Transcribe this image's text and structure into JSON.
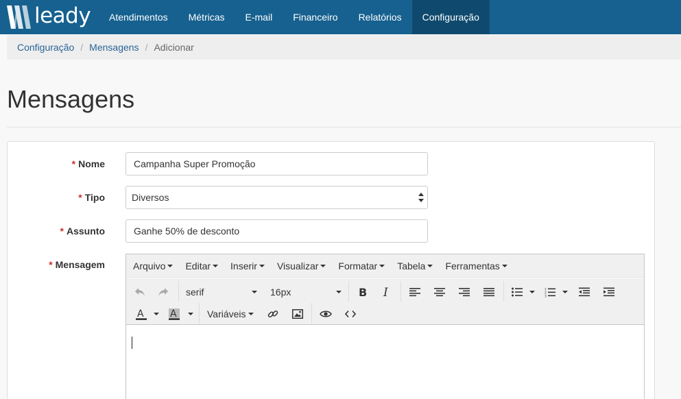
{
  "app": {
    "logo_text": "leady"
  },
  "nav": {
    "items": [
      {
        "label": "Atendimentos"
      },
      {
        "label": "Métricas"
      },
      {
        "label": "E-mail"
      },
      {
        "label": "Financeiro"
      },
      {
        "label": "Relatórios"
      },
      {
        "label": "Configuração",
        "active": true
      }
    ]
  },
  "breadcrumb": {
    "items": [
      "Configuração",
      "Mensagens",
      "Adicionar"
    ],
    "separator": "/"
  },
  "page": {
    "title": "Mensagens"
  },
  "form": {
    "required_marker": "*",
    "nome": {
      "label": "Nome",
      "value": "Campanha Super Promoção"
    },
    "tipo": {
      "label": "Tipo",
      "value": "Diversos"
    },
    "assunto": {
      "label": "Assunto",
      "value": "Ganhe 50% de desconto"
    },
    "mensagem": {
      "label": "Mensagem"
    }
  },
  "editor": {
    "menus": [
      "Arquivo",
      "Editar",
      "Inserir",
      "Visualizar",
      "Formatar",
      "Tabela",
      "Ferramentas"
    ],
    "font_family": "serif",
    "font_size": "16px",
    "variables_label": "Variáveis",
    "content": ""
  },
  "colors": {
    "navbar": "#16618f",
    "navbar_active": "#0f4a6e",
    "link": "#2a6496",
    "required": "#c9302c"
  }
}
